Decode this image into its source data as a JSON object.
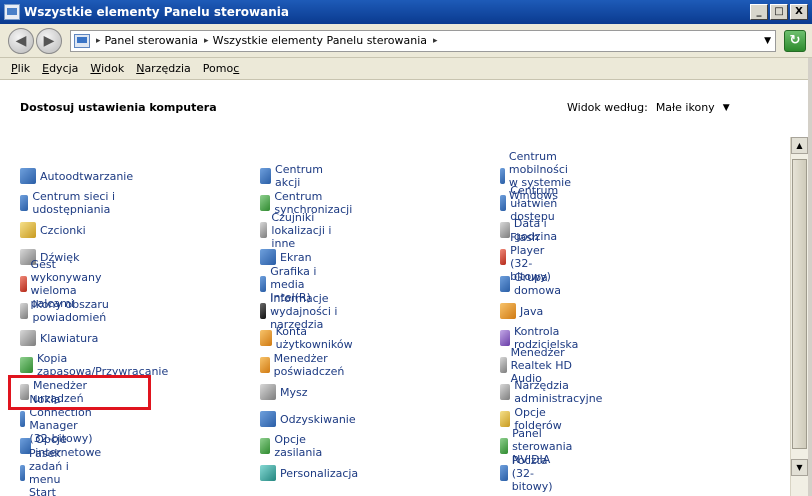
{
  "window": {
    "title": "Wszystkie elementy Panelu sterowania",
    "minimize": "_",
    "maximize": "□",
    "close": "X"
  },
  "nav": {
    "back": "◀",
    "forward": "▶",
    "crumbs": [
      "Panel sterowania",
      "Wszystkie elementy Panelu sterowania"
    ],
    "crumb_separator": "▸",
    "dropdown": "▼",
    "refresh": "↻"
  },
  "menu": [
    {
      "first": "P",
      "rest": "lik"
    },
    {
      "first": "E",
      "rest": "dycja"
    },
    {
      "first": "W",
      "rest": "idok"
    },
    {
      "first": "N",
      "rest": "arzędzia"
    },
    {
      "first": "",
      "rest": "Pomo",
      "tail_u": "c"
    }
  ],
  "header": {
    "title": "Dostosuj ustawienia komputera",
    "view_label": "Widok według:",
    "view_value": "Małe ikony",
    "view_arrow": "▼"
  },
  "columns": [
    [
      {
        "label": "Autoodtwarzanie",
        "icon": "autoplay-icon",
        "color": "ico-b"
      },
      {
        "label": "Centrum sieci i udostępniania",
        "icon": "network-icon",
        "color": "ico-b"
      },
      {
        "label": "Czcionki",
        "icon": "fonts-icon",
        "color": "ico-y"
      },
      {
        "label": "Dźwięk",
        "icon": "speaker-icon",
        "color": "ico-gr"
      },
      {
        "label": "Gest wykonywany wieloma palcami",
        "icon": "touch-gesture-icon",
        "color": "ico-r"
      },
      {
        "label": "Ikony obszaru powiadomień",
        "icon": "notification-icons-icon",
        "color": "ico-gr"
      },
      {
        "label": "Klawiatura",
        "icon": "keyboard-icon",
        "color": "ico-gr"
      },
      {
        "label": "Kopia zapasowa/Przywracanie",
        "icon": "backup-icon",
        "color": "ico-g"
      },
      {
        "label": "Menedżer urządzeń",
        "icon": "device-manager-icon",
        "color": "ico-gr"
      },
      {
        "label": "Nokia Connection Manager (32-bitowy)",
        "icon": "nokia-icon",
        "color": "ico-b"
      },
      {
        "label": "Opcje internetowe",
        "icon": "internet-options-icon",
        "color": "ico-b"
      },
      {
        "label": "Pasek zadań i menu Start",
        "icon": "taskbar-icon",
        "color": "ico-b"
      }
    ],
    [
      {
        "label": "Centrum akcji",
        "icon": "action-center-flag-icon",
        "color": "ico-b"
      },
      {
        "label": "Centrum synchronizacji",
        "icon": "sync-center-icon",
        "color": "ico-g"
      },
      {
        "label": "Czujniki lokalizacji i inne",
        "icon": "sensors-icon",
        "color": "ico-gr"
      },
      {
        "label": "Ekran",
        "icon": "display-icon",
        "color": "ico-b"
      },
      {
        "label": "Grafika i media Intel(R)",
        "icon": "intel-graphics-icon",
        "color": "ico-b"
      },
      {
        "label": "Informacje wydajności i narzędzia",
        "icon": "performance-icon",
        "color": "ico-k"
      },
      {
        "label": "Konta użytkowników",
        "icon": "user-accounts-icon",
        "color": "ico-o"
      },
      {
        "label": "Menedżer poświadczeń",
        "icon": "credential-manager-icon",
        "color": "ico-o"
      },
      {
        "label": "Mysz",
        "icon": "mouse-icon",
        "color": "ico-gr"
      },
      {
        "label": "Odzyskiwanie",
        "icon": "recovery-icon",
        "color": "ico-b"
      },
      {
        "label": "Opcje zasilania",
        "icon": "power-options-icon",
        "color": "ico-g"
      },
      {
        "label": "Personalizacja",
        "icon": "personalization-icon",
        "color": "ico-t"
      }
    ],
    [
      {
        "label": "Centrum mobilności w systemie Windows",
        "icon": "mobility-center-icon",
        "color": "ico-b"
      },
      {
        "label": "Centrum ułatwień dostępu",
        "icon": "ease-of-access-icon",
        "color": "ico-b"
      },
      {
        "label": "Data i godzina",
        "icon": "date-time-icon",
        "color": "ico-gr"
      },
      {
        "label": "Flash Player (32-bitowy)",
        "icon": "flash-player-icon",
        "color": "ico-r"
      },
      {
        "label": "Grupa domowa",
        "icon": "homegroup-icon",
        "color": "ico-b"
      },
      {
        "label": "Java",
        "icon": "java-icon",
        "color": "ico-o"
      },
      {
        "label": "Kontrola rodzicielska",
        "icon": "parental-controls-icon",
        "color": "ico-p"
      },
      {
        "label": "Menedżer Realtek HD Audio",
        "icon": "realtek-audio-icon",
        "color": "ico-gr"
      },
      {
        "label": "Narzędzia administracyjne",
        "icon": "admin-tools-icon",
        "color": "ico-gr"
      },
      {
        "label": "Opcje folderów",
        "icon": "folder-options-icon",
        "color": "ico-y"
      },
      {
        "label": "Panel sterowania NVIDIA",
        "icon": "nvidia-icon",
        "color": "ico-g"
      },
      {
        "label": "Poczta (32-bitowy)",
        "icon": "mail-icon",
        "color": "ico-b"
      }
    ]
  ],
  "scrollbar": {
    "up": "▲",
    "down": "▼"
  }
}
